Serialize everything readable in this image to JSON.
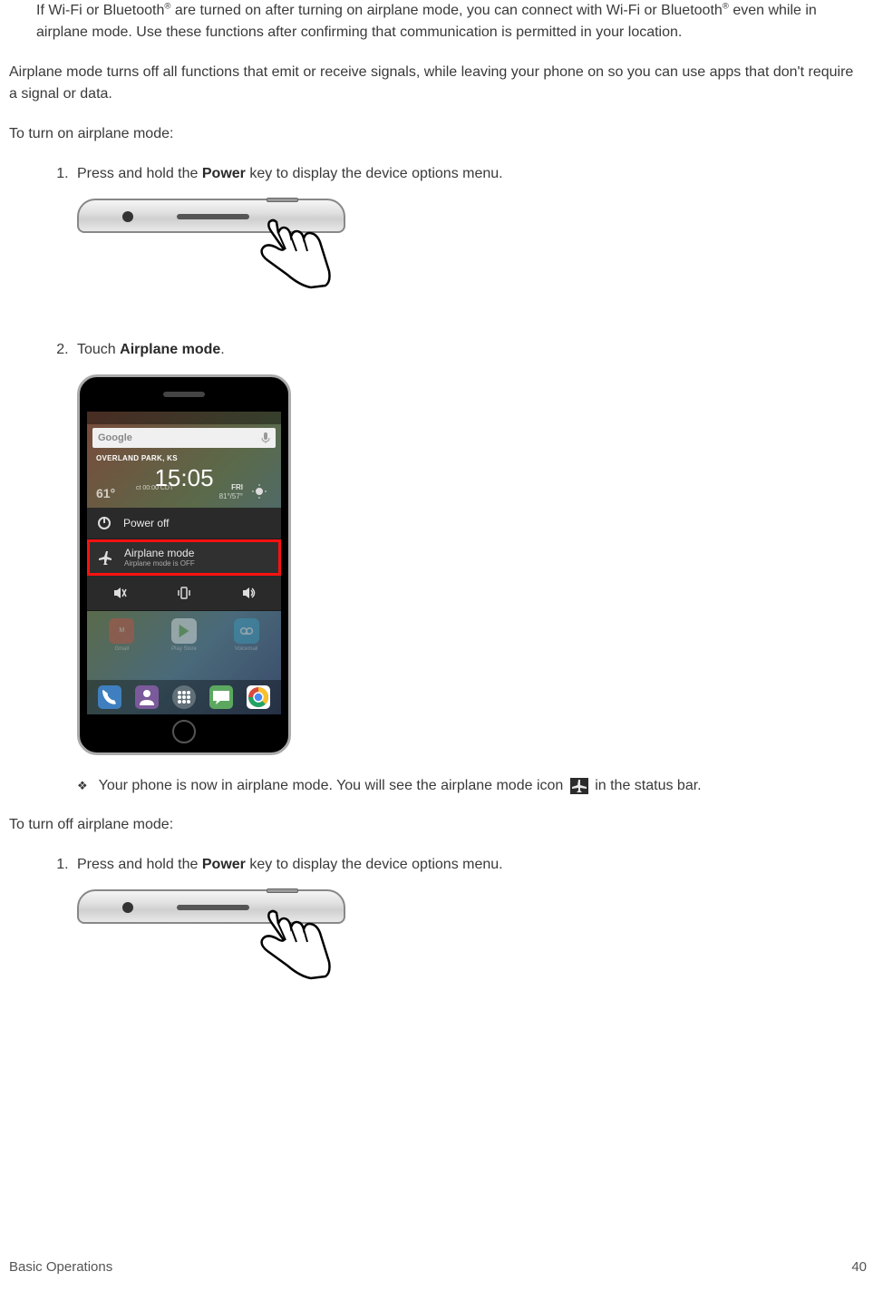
{
  "note": {
    "p1a": "If Wi-Fi or Bluetooth",
    "p1b": " are turned on after turning on airplane mode, you can connect with Wi-Fi or Bluetooth",
    "p1c": " even while in airplane mode. Use these functions after confirming that communication is permitted in your location.",
    "sup": "®"
  },
  "para_intro": "Airplane mode turns off all functions that emit or receive signals, while leaving your phone on so you can use apps that don't require a signal or data.",
  "para_on": "To turn on airplane mode:",
  "step1a": "Press and hold the ",
  "step1b": "Power",
  "step1c": " key to display the device options menu.",
  "step2a": "Touch ",
  "step2b": "Airplane mode",
  "step2c": ".",
  "bullet_a": "Your phone is now in airplane mode. You will see the airplane mode icon ",
  "bullet_b": " in the status bar.",
  "para_off": "To turn off airplane mode:",
  "screen": {
    "search": "Google",
    "location": "OVERLAND PARK, KS",
    "time": "15:05",
    "temp": "61°",
    "clock": "ct 00:00 CDT",
    "day": "FRI",
    "hilo": "81°/57°",
    "menu_power": "Power off",
    "menu_airplane": "Airplane mode",
    "menu_airplane_sub": "Airplane mode is OFF",
    "app1": "Gmail",
    "app2": "Play Store",
    "app3": "Voicemail"
  },
  "footer_left": "Basic Operations",
  "footer_right": "40"
}
